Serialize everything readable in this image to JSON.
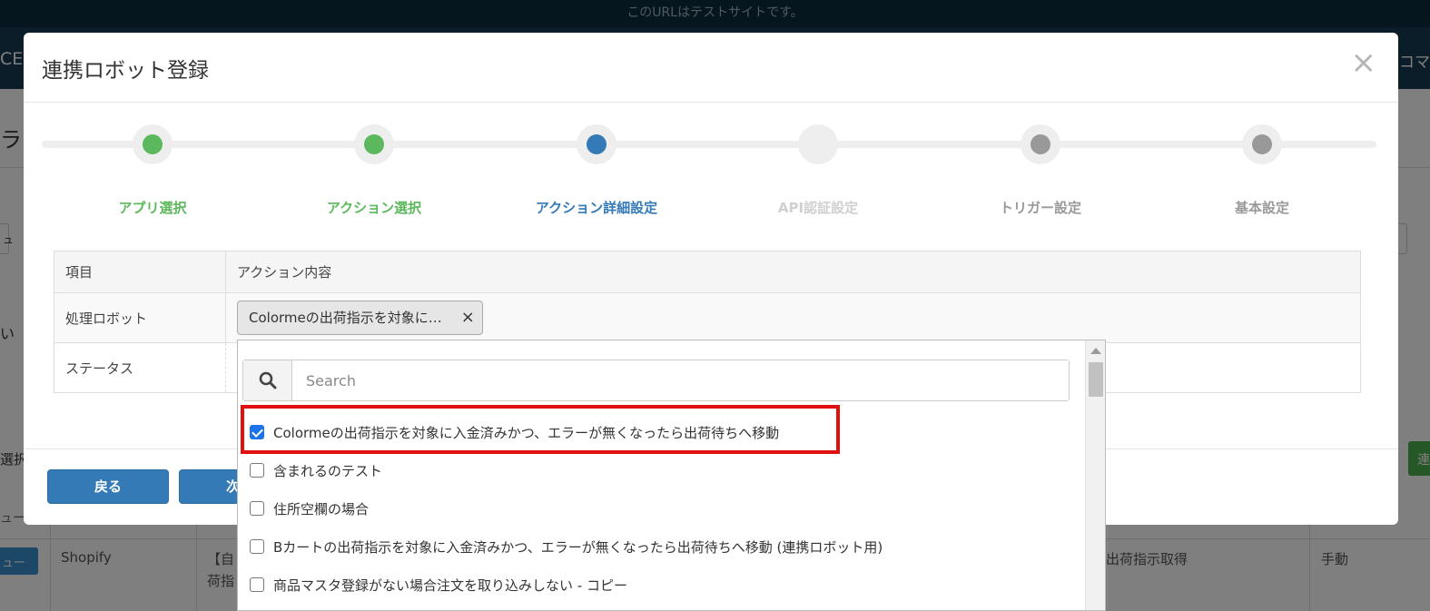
{
  "site_banner": "このURLはテストサイトです。",
  "background": {
    "nav_left": "CE",
    "nav_right": "コマ",
    "heading": "ラ",
    "input_left": "ュ",
    "text_i": "い",
    "text_select": "選択",
    "green_button": "連",
    "text_menu": "ュー",
    "row_button": "ュー",
    "cell_shopify": "Shopify",
    "cell_auto": "【自",
    "cell_auto2": "荷指",
    "cell_shipping": "出荷指示取得",
    "cell_manual": "手動"
  },
  "modal": {
    "title": "連携ロボット登録",
    "close_label": "×"
  },
  "stepper": {
    "steps": [
      {
        "label": "アプリ選択",
        "state": "done",
        "color": "#5cb85c"
      },
      {
        "label": "アクション選択",
        "state": "done",
        "color": "#5cb85c"
      },
      {
        "label": "アクション詳細設定",
        "state": "active",
        "color": "#337ab7"
      },
      {
        "label": "API認証設定",
        "state": "hidden",
        "color": "#d0d0d0"
      },
      {
        "label": "トリガー設定",
        "state": "pending",
        "color": "#999999"
      },
      {
        "label": "基本設定",
        "state": "pending",
        "color": "#999999"
      }
    ]
  },
  "table": {
    "header_item": "項目",
    "header_action": "アクション内容",
    "row1_label": "処理ロボット",
    "row2_label": "ステータス",
    "selected_tag": "Colormeの出荷指示を対象に入金済みかつ、エラーが無くなったら出荷待ちへ移動",
    "tag_remove": "×"
  },
  "footer": {
    "back_label": "戻る",
    "next_label": "次へ"
  },
  "dropdown": {
    "search_placeholder": "Search",
    "search_value": "",
    "options": [
      {
        "label": "Colormeの出荷指示を対象に入金済みかつ、エラーが無くなったら出荷待ちへ移動",
        "checked": true
      },
      {
        "label": "含まれるのテスト",
        "checked": false
      },
      {
        "label": "住所空欄の場合",
        "checked": false
      },
      {
        "label": "Bカートの出荷指示を対象に入金済みかつ、エラーが無くなったら出荷待ちへ移動 (連携ロボット用)",
        "checked": false
      },
      {
        "label": "商品マスタ登録がない場合注文を取り込みしない - コピー",
        "checked": false
      }
    ]
  },
  "colors": {
    "done": "#5cb85c",
    "active": "#337ab7",
    "pending": "#999999",
    "highlight": "#e01010"
  }
}
